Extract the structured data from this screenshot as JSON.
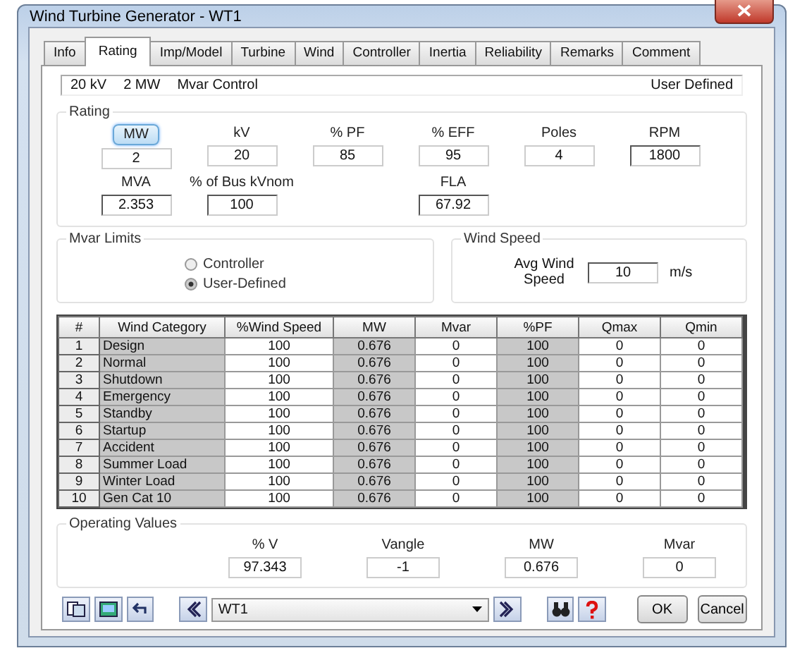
{
  "window": {
    "title": "Wind Turbine Generator - WT1"
  },
  "tabs": [
    {
      "label": "Info",
      "selected": false
    },
    {
      "label": "Rating",
      "selected": true
    },
    {
      "label": "Imp/Model",
      "selected": false
    },
    {
      "label": "Turbine",
      "selected": false
    },
    {
      "label": "Wind",
      "selected": false
    },
    {
      "label": "Controller",
      "selected": false
    },
    {
      "label": "Inertia",
      "selected": false
    },
    {
      "label": "Reliability",
      "selected": false
    },
    {
      "label": "Remarks",
      "selected": false
    },
    {
      "label": "Comment",
      "selected": false
    }
  ],
  "info_bar": {
    "items": [
      "20 kV",
      "2 MW",
      "Mvar Control"
    ],
    "mode": "User Defined"
  },
  "rating": {
    "title": "Rating",
    "rows": [
      [
        {
          "label": "MW",
          "value": "2",
          "highlighted": true,
          "disabled": true
        },
        {
          "label": "kV",
          "value": "20",
          "highlighted": false,
          "disabled": true
        },
        {
          "label": "% PF",
          "value": "85",
          "highlighted": false,
          "disabled": true
        },
        {
          "label": "% EFF",
          "value": "95",
          "highlighted": false,
          "disabled": true
        },
        {
          "label": "Poles",
          "value": "4",
          "highlighted": false,
          "disabled": true
        },
        {
          "label": "RPM",
          "value": "1800",
          "highlighted": false,
          "disabled": false
        }
      ],
      [
        {
          "label": "MVA",
          "value": "2.353",
          "highlighted": false,
          "disabled": false
        },
        {
          "label": "% of Bus kVnom",
          "value": "100",
          "highlighted": false,
          "disabled": false
        },
        "",
        {
          "label": "FLA",
          "value": "67.92",
          "highlighted": false,
          "disabled": false
        }
      ]
    ]
  },
  "mvar_limits": {
    "title": "Mvar Limits",
    "options": [
      {
        "label": "Controller",
        "selected": false
      },
      {
        "label": "User-Defined",
        "selected": true
      }
    ]
  },
  "wind_speed": {
    "title": "Wind Speed",
    "label": "Avg Wind Speed",
    "value": "10",
    "unit": "m/s"
  },
  "table": {
    "columns": [
      {
        "label": "#"
      },
      {
        "label": "Wind Category",
        "shaded": true
      },
      {
        "label": "%Wind Speed",
        "shaded": false
      },
      {
        "label": "MW",
        "shaded": true
      },
      {
        "label": "Mvar",
        "shaded": false
      },
      {
        "label": "%PF",
        "shaded": true
      },
      {
        "label": "Qmax",
        "shaded": false
      },
      {
        "label": "Qmin",
        "shaded": false
      }
    ],
    "rows": [
      [
        "1",
        "Design",
        "100",
        "0.676",
        "0",
        "100",
        "0",
        "0"
      ],
      [
        "2",
        "Normal",
        "100",
        "0.676",
        "0",
        "100",
        "0",
        "0"
      ],
      [
        "3",
        "Shutdown",
        "100",
        "0.676",
        "0",
        "100",
        "0",
        "0"
      ],
      [
        "4",
        "Emergency",
        "100",
        "0.676",
        "0",
        "100",
        "0",
        "0"
      ],
      [
        "5",
        "Standby",
        "100",
        "0.676",
        "0",
        "100",
        "0",
        "0"
      ],
      [
        "6",
        "Startup",
        "100",
        "0.676",
        "0",
        "100",
        "0",
        "0"
      ],
      [
        "7",
        "Accident",
        "100",
        "0.676",
        "0",
        "100",
        "0",
        "0"
      ],
      [
        "8",
        "Summer Load",
        "100",
        "0.676",
        "0",
        "100",
        "0",
        "0"
      ],
      [
        "9",
        "Winter Load",
        "100",
        "0.676",
        "0",
        "100",
        "0",
        "0"
      ],
      [
        "10",
        "Gen Cat 10",
        "100",
        "0.676",
        "0",
        "100",
        "0",
        "0"
      ]
    ]
  },
  "operating_values": {
    "title": "Operating Values",
    "fields": [
      {
        "label": "% V",
        "value": "97.343"
      },
      {
        "label": "Vangle",
        "value": "-1"
      },
      {
        "label": "MW",
        "value": "0.676"
      },
      {
        "label": "Mvar",
        "value": "0"
      }
    ]
  },
  "footer": {
    "selector": "WT1",
    "buttons": [
      "OK",
      "Cancel"
    ]
  }
}
